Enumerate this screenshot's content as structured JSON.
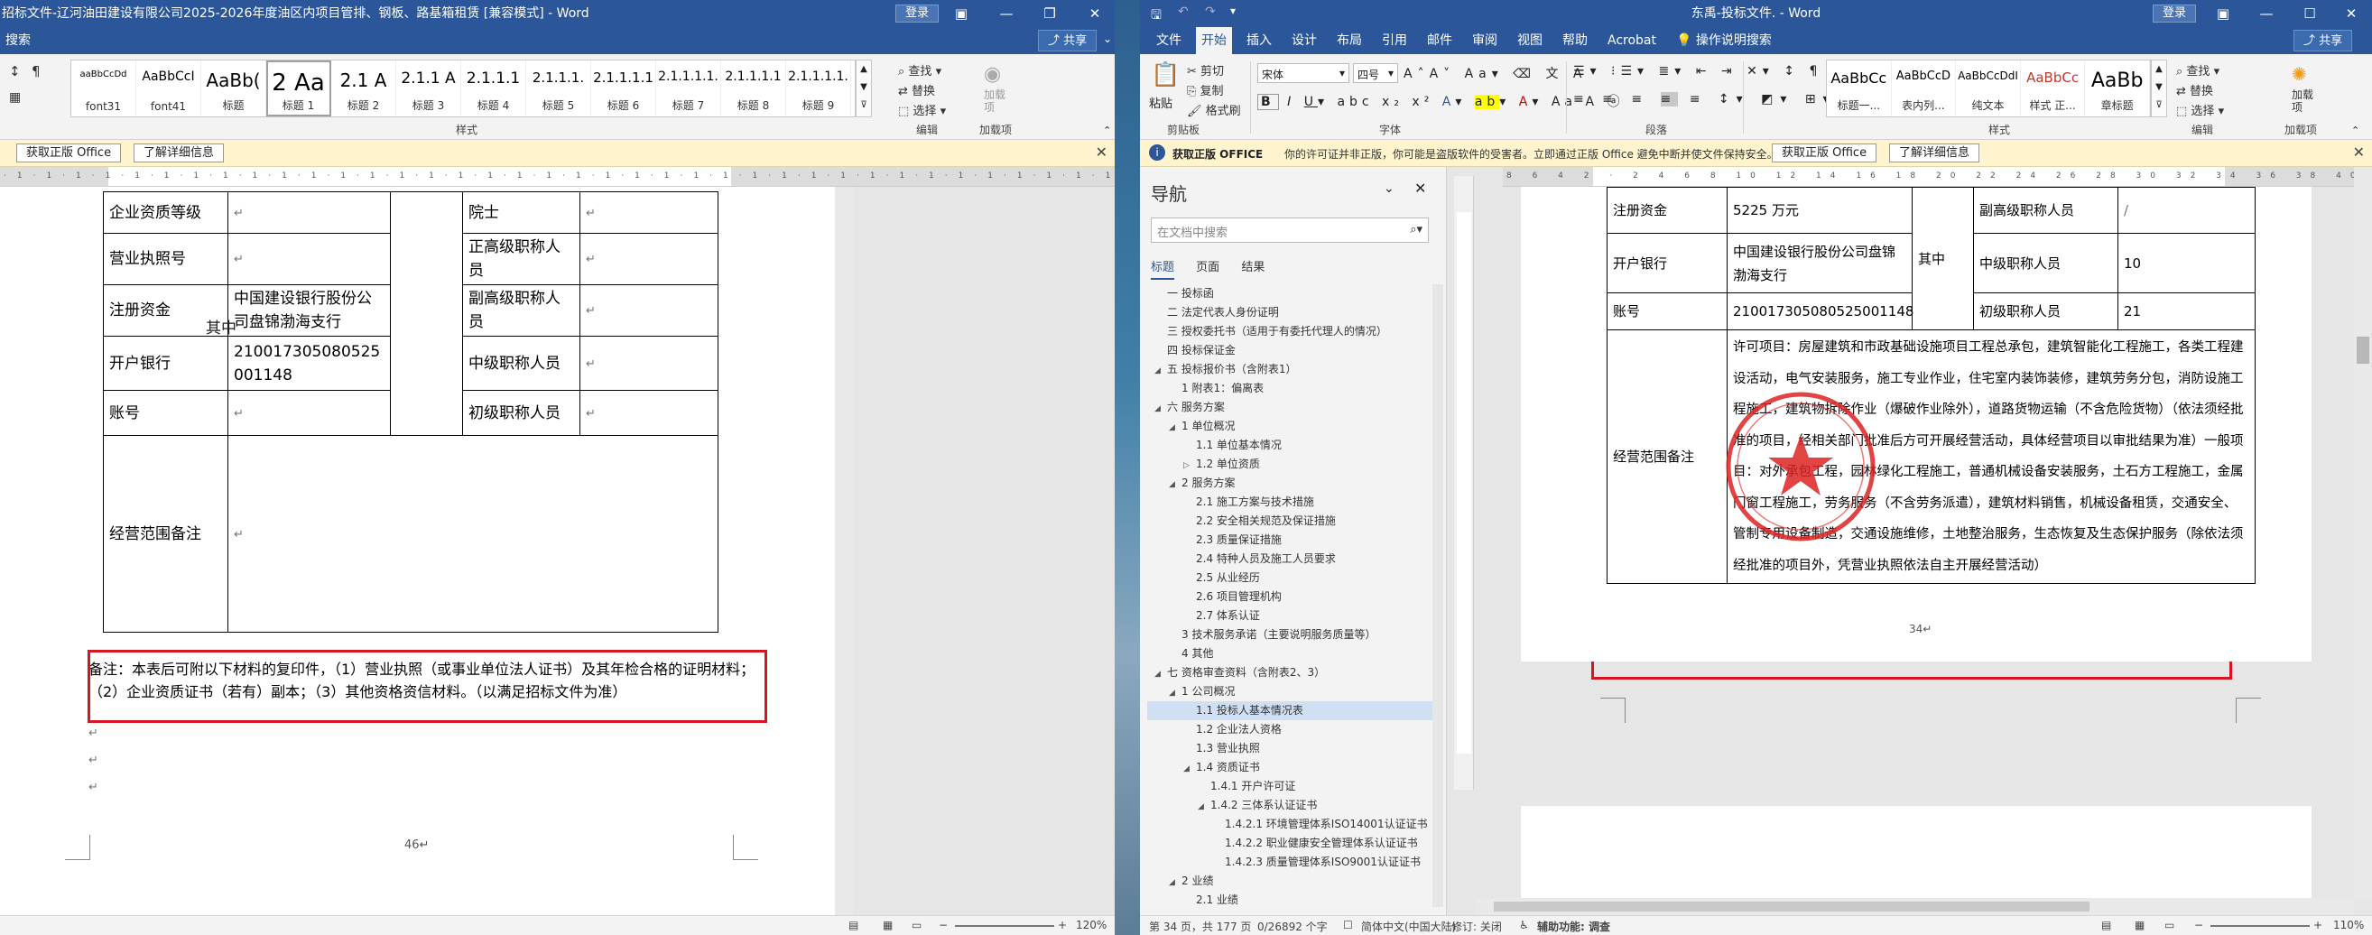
{
  "left": {
    "title": "招标文件-辽河油田建设有限公司2025-2026年度油区内项目管排、钢板、路基箱租赁 [兼容模式] - Word",
    "login": "登录",
    "tabs": [
      "搜索"
    ],
    "share": "共享",
    "styles": [
      {
        "preview": "aaBbCcDd",
        "name": "font31"
      },
      {
        "preview": "AaBbCcI",
        "name": "font41"
      },
      {
        "preview": "AaBb(",
        "name": "标题"
      },
      {
        "preview": "2 Aa",
        "name": "标题 1"
      },
      {
        "preview": "2.1 A",
        "name": "标题 2"
      },
      {
        "preview": "2.1.1 A",
        "name": "标题 3"
      },
      {
        "preview": "2.1.1.1",
        "name": "标题 4"
      },
      {
        "preview": "2.1.1.1.",
        "name": "标题 5"
      },
      {
        "preview": "2.1.1.1.1",
        "name": "标题 6"
      },
      {
        "preview": "2.1.1.1.1.",
        "name": "标题 7"
      },
      {
        "preview": "2.1.1.1.1",
        "name": "标题 8"
      },
      {
        "preview": "2.1.1.1.1.",
        "name": "标题 9"
      }
    ],
    "group_styles": "样式",
    "group_edit": "编辑",
    "group_addins": "加载项",
    "edit_find": "查找",
    "edit_replace": "替换",
    "edit_select": "选择",
    "addins_label": "加载项",
    "notice_btn1": "获取正版 Office",
    "notice_btn2": "了解详细信息",
    "table": {
      "r1_label": "企业资质等级",
      "r1_right_label": "院士",
      "r2_label": "营业执照号",
      "r2_right_label": "正高级职称人员",
      "r3_label": "注册资金",
      "r3_value": "中国建设银行股份公司盘锦渤海支行",
      "r3_mid": "其中",
      "r3_right_label": "副高级职称人员",
      "r4_label": "开户银行",
      "r4_value": "210017305080525001148",
      "r4_right_label": "中级职称人员",
      "r5_label": "账号",
      "r5_right_label": "初级职称人员",
      "r6_label": "经营范围备注"
    },
    "note_text": "备注：本表后可附以下材料的复印件，（1）营业执照（或事业单位法人证书）及其年检合格的证明材料；（2）企业资质证书（若有）副本；（3）其他资格资信材料。（以满足招标文件为准）",
    "page_number": "46",
    "zoom": "120%"
  },
  "right": {
    "title": "东禹-投标文件. - Word",
    "login": "登录",
    "tabs": [
      "文件",
      "开始",
      "插入",
      "设计",
      "布局",
      "引用",
      "邮件",
      "审阅",
      "视图",
      "帮助",
      "Acrobat",
      "操作说明搜索"
    ],
    "active_tab": "开始",
    "share": "共享",
    "clipboard": {
      "paste": "粘贴",
      "cut": "剪切",
      "copy": "复制",
      "format": "格式刷",
      "group": "剪贴板"
    },
    "font": {
      "name": "宋体",
      "size": "四号",
      "group": "字体"
    },
    "group_para": "段落",
    "styles": [
      {
        "preview": "AaBbCc",
        "name": "标题一..."
      },
      {
        "preview": "AaBbCcD",
        "name": "表内列..."
      },
      {
        "preview": "AaBbCcDdI",
        "name": "纯文本"
      },
      {
        "preview": "AaBbCc",
        "name": "样式 正..."
      },
      {
        "preview": "AaBb",
        "name": "章标题"
      }
    ],
    "group_styles": "样式",
    "edit_find": "查找",
    "edit_replace": "替换",
    "edit_select": "选择",
    "group_edit": "编辑",
    "addins_label": "加载项",
    "notice_title": "获取正版 OFFICE",
    "notice_text": "你的许可证并非正版，你可能是盗版软件的受害者。立即通过正版 Office 避免中断并使文件保持安全。",
    "notice_btn1": "获取正版 Office",
    "notice_btn2": "了解详细信息",
    "nav": {
      "title": "导航",
      "search_placeholder": "在文档中搜索",
      "tabs": [
        "标题",
        "页面",
        "结果"
      ],
      "items": [
        {
          "text": "一 投标函",
          "level": 0,
          "arrow": ""
        },
        {
          "text": "二 法定代表人身份证明",
          "level": 0,
          "arrow": ""
        },
        {
          "text": "三 授权委托书（适用于有委托代理人的情况）",
          "level": 0,
          "arrow": ""
        },
        {
          "text": "四 投标保证金",
          "level": 0,
          "arrow": ""
        },
        {
          "text": "五 投标报价书（含附表1）",
          "level": 0,
          "arrow": "◢"
        },
        {
          "text": "1 附表1：偏离表",
          "level": 1,
          "arrow": ""
        },
        {
          "text": "六 服务方案",
          "level": 0,
          "arrow": "◢"
        },
        {
          "text": "1 单位概况",
          "level": 1,
          "arrow": "◢"
        },
        {
          "text": "1.1 单位基本情况",
          "level": 2,
          "arrow": ""
        },
        {
          "text": "1.2 单位资质",
          "level": 2,
          "arrow": "▷"
        },
        {
          "text": "2 服务方案",
          "level": 1,
          "arrow": "◢"
        },
        {
          "text": "2.1 施工方案与技术措施",
          "level": 2,
          "arrow": ""
        },
        {
          "text": "2.2 安全相关规范及保证措施",
          "level": 2,
          "arrow": ""
        },
        {
          "text": "2.3 质量保证措施",
          "level": 2,
          "arrow": ""
        },
        {
          "text": "2.4 特种人员及施工人员要求",
          "level": 2,
          "arrow": ""
        },
        {
          "text": "2.5 从业经历",
          "level": 2,
          "arrow": ""
        },
        {
          "text": "2.6 项目管理机构",
          "level": 2,
          "arrow": ""
        },
        {
          "text": "2.7 体系认证",
          "level": 2,
          "arrow": ""
        },
        {
          "text": "3 技术服务承诺（主要说明服务质量等）",
          "level": 1,
          "arrow": ""
        },
        {
          "text": "4 其他",
          "level": 1,
          "arrow": ""
        },
        {
          "text": "七 资格审查资料（含附表2、3）",
          "level": 0,
          "arrow": "◢"
        },
        {
          "text": "1 公司概况",
          "level": 1,
          "arrow": "◢"
        },
        {
          "text": "1.1 投标人基本情况表",
          "level": 2,
          "arrow": "",
          "hl": true
        },
        {
          "text": "1.2 企业法人资格",
          "level": 2,
          "arrow": ""
        },
        {
          "text": "1.3 营业执照",
          "level": 2,
          "arrow": ""
        },
        {
          "text": "1.4 资质证书",
          "level": 2,
          "arrow": "◢"
        },
        {
          "text": "1.4.1 开户许可证",
          "level": 3,
          "arrow": ""
        },
        {
          "text": "1.4.2 三体系认证证书",
          "level": 3,
          "arrow": "◢"
        },
        {
          "text": "1.4.2.1 环境管理体系ISO14001认证证书",
          "level": 4,
          "arrow": ""
        },
        {
          "text": "1.4.2.2 职业健康安全管理体系认证证书",
          "level": 4,
          "arrow": ""
        },
        {
          "text": "1.4.2.3 质量管理体系ISO9001认证证书",
          "level": 4,
          "arrow": ""
        },
        {
          "text": "2 业绩",
          "level": 1,
          "arrow": "◢"
        },
        {
          "text": "2.1 业绩",
          "level": 2,
          "arrow": ""
        }
      ]
    },
    "table": {
      "r1_label": "注册资金",
      "r1_value": "5225 万元",
      "r1_right_label": "副高级职称人员",
      "r1_right_value": "/",
      "mid": "其中",
      "r2_label": "开户银行",
      "r2_value": "中国建设银行股份公司盘锦渤海支行",
      "r2_right_label": "中级职称人员",
      "r2_right_value": "10",
      "r3_label": "账号",
      "r3_value": "210017305080525001148",
      "r3_right_label": "初级职称人员",
      "r3_right_value": "21",
      "r4_label": "经营范围备注",
      "r4_value": "许可项目：房屋建筑和市政基础设施项目工程总承包，建筑智能化工程施工，各类工程建设活动，电气安装服务，施工专业作业，住宅室内装饰装修，建筑劳务分包，消防设施工程施工，建筑物拆除作业（爆破作业除外），道路货物运输（不含危险货物）（依法须经批准的项目，经相关部门批准后方可开展经营活动，具体经营项目以审批结果为准）一般项目：对外承包工程，园林绿化工程施工，普通机械设备安装服务，土石方工程施工，金属门窗工程施工，劳务服务（不含劳务派遣），建筑材料销售，机械设备租赁，交通安全、管制专用设备制造，交通设施维修，土地整治服务，生态恢复及生态保护服务（除依法须经批准的项目外，凭营业执照依法自主开展经营活动）"
    },
    "page_number": "34",
    "status": {
      "page": "第 34 页，共 177 页",
      "words": "0/26892 个字",
      "lang": "简体中文(中国大陆)",
      "track": "修订: 关闭",
      "access": "辅助功能: 调查"
    },
    "zoom": "110%"
  }
}
